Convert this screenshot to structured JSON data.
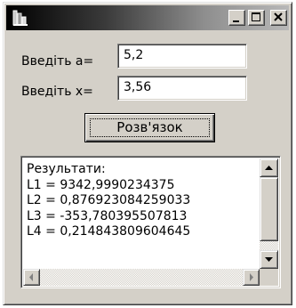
{
  "form": {
    "label_a": "Введіть a=",
    "value_a": "5,2",
    "label_x": "Введіть x=",
    "value_x": "3,56",
    "solve_button": "Розв'язок"
  },
  "results": {
    "lines": [
      "Результати:",
      "L1 = 9342,9990234375",
      "L2 = 0,876923084259033",
      "L3 = -353,780395507813",
      "L4 = 0,214843809604645"
    ]
  },
  "icons": {
    "app": "app-icon",
    "minimize": "minimize-icon",
    "maximize": "maximize-icon",
    "close": "close-icon"
  }
}
